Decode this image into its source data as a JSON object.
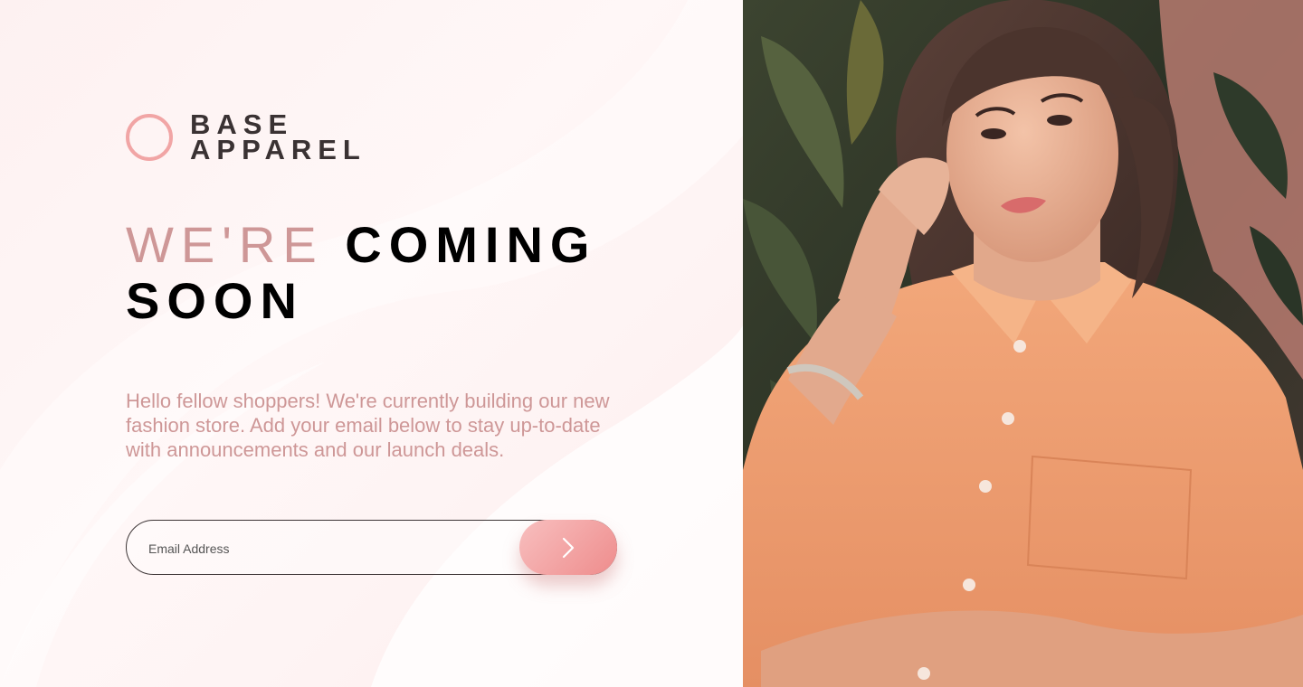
{
  "brand": {
    "line1": "BASE",
    "line2": "APPAREL"
  },
  "headline": {
    "light": "WE'RE",
    "dark1": "COMING",
    "dark2": "SOON"
  },
  "description": "Hello fellow shoppers! We're currently building our new fashion store. Add your email below to stay up-to-date with announcements and our launch deals.",
  "form": {
    "email_placeholder": "Email Address",
    "submit_icon": "chevron-right-icon"
  },
  "hero": {
    "alt": "Woman in an orange shirt"
  },
  "colors": {
    "accent_pink": "#ce9797",
    "button_gradient_start": "#f8bfbf",
    "button_gradient_end": "#ee8c8c",
    "text_dark": "#3a3233"
  }
}
